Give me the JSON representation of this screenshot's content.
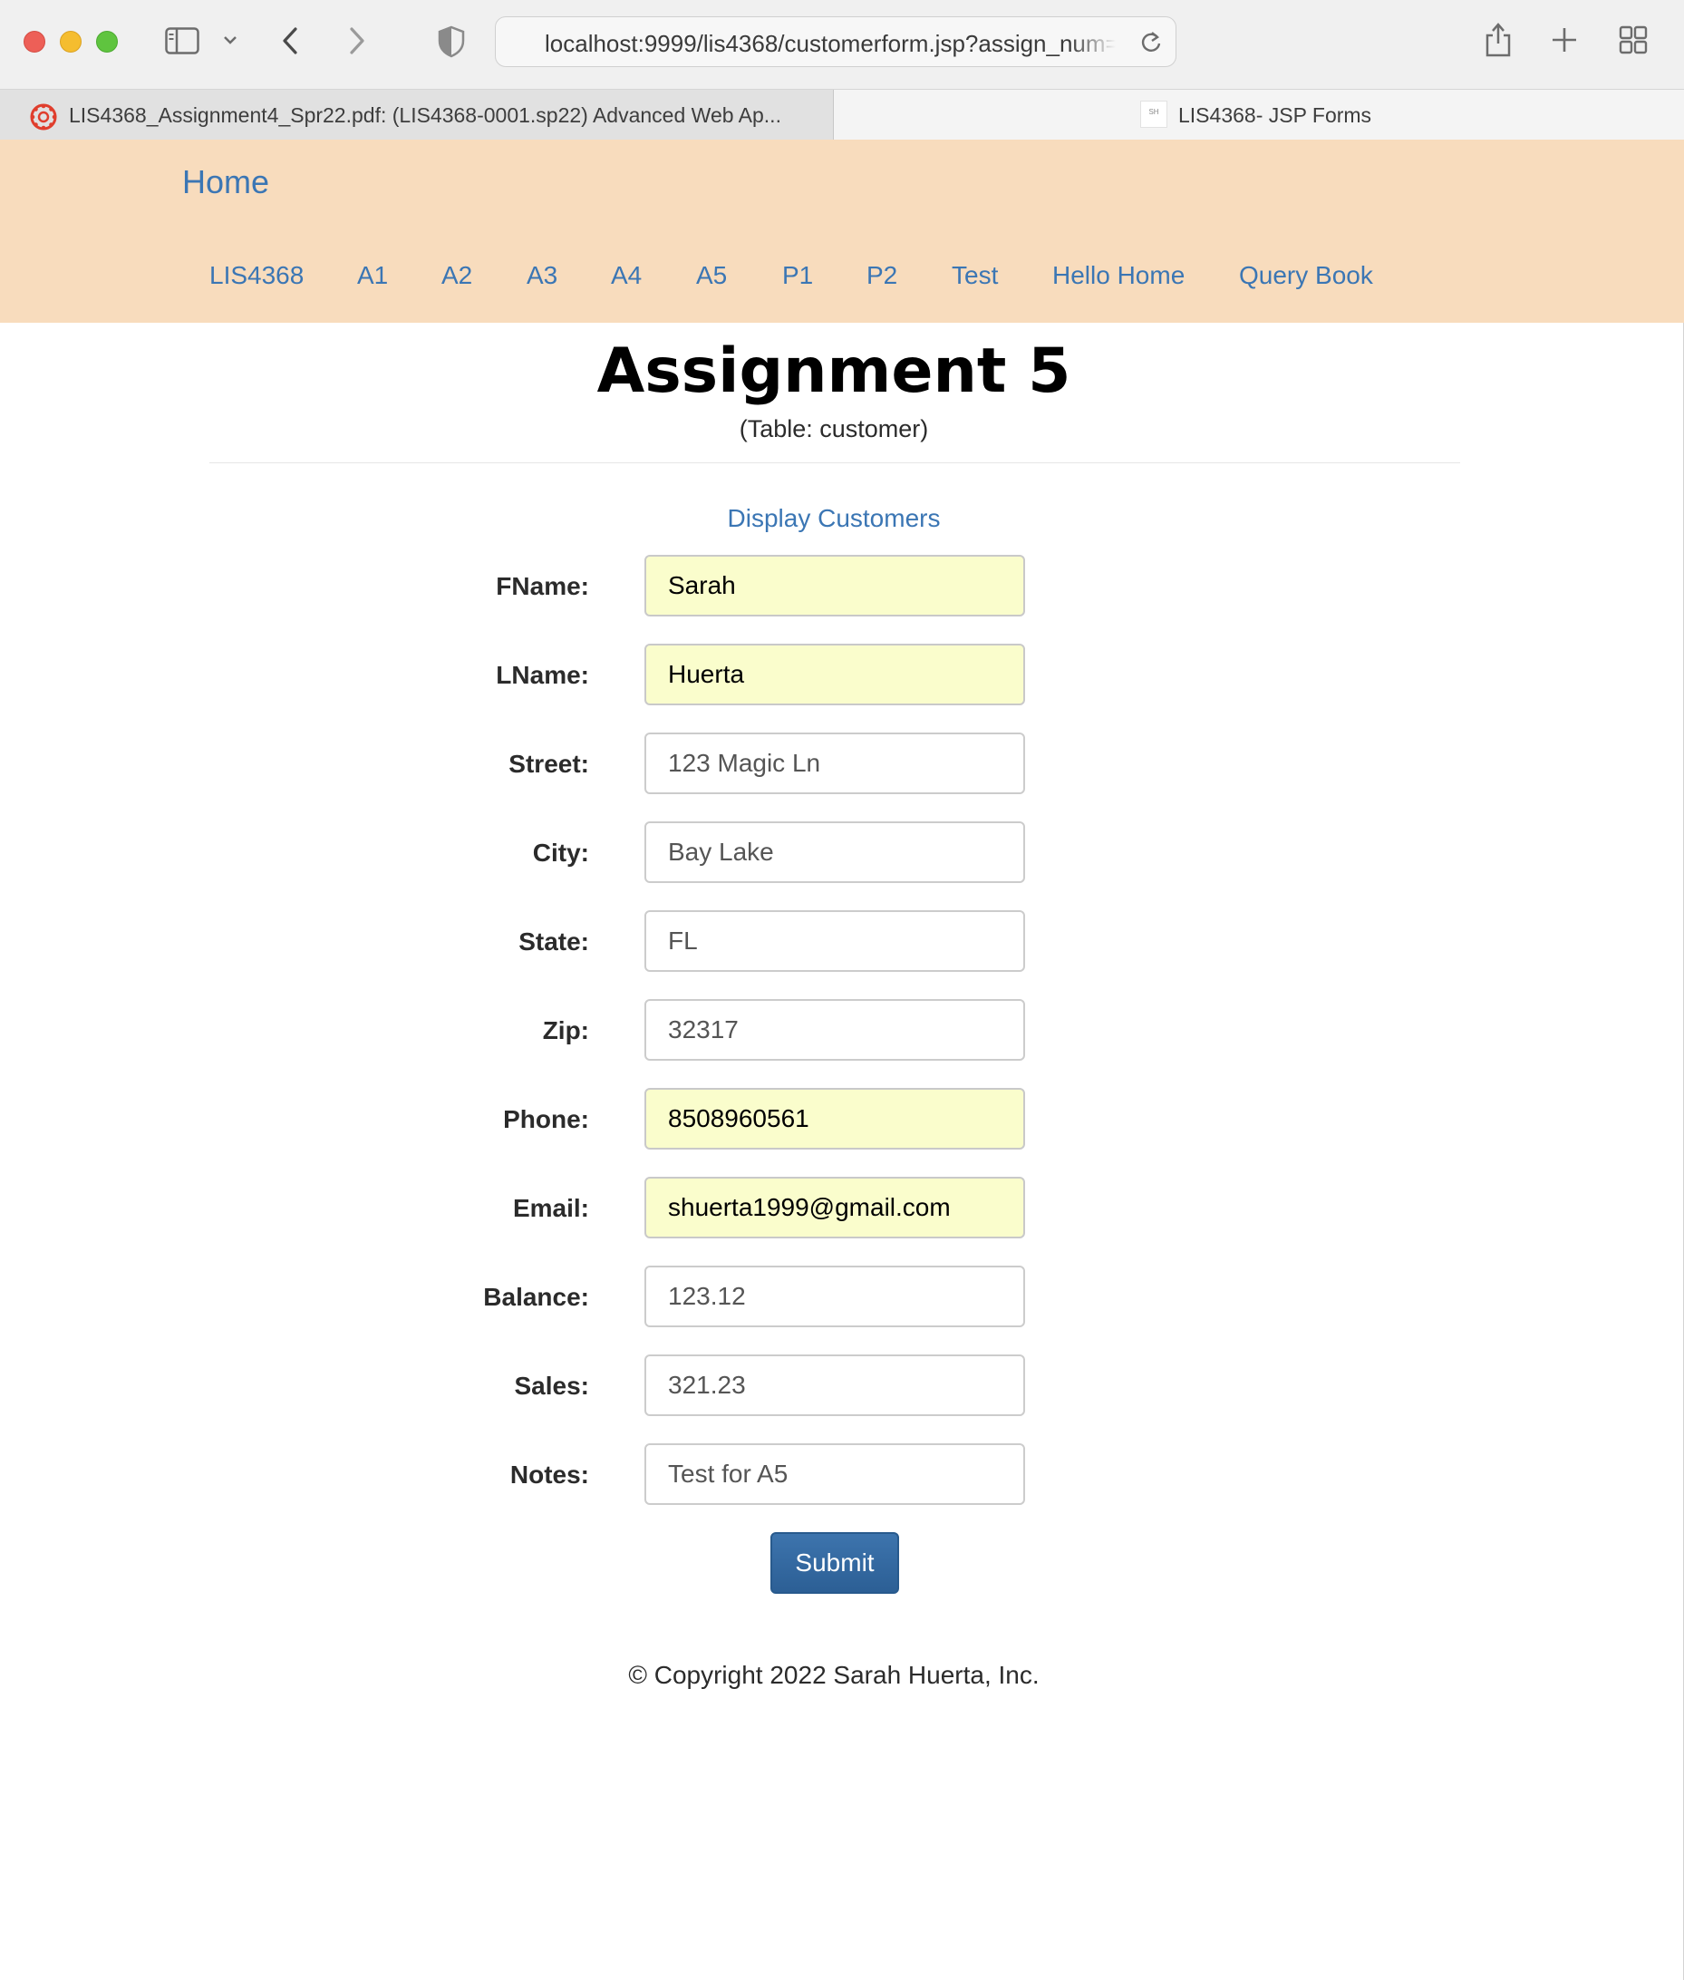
{
  "browser": {
    "url": "localhost:9999/lis4368/customerform.jsp?assign_num=a5",
    "tabs": [
      {
        "title": "LIS4368_Assignment4_Spr22.pdf: (LIS4368-0001.sp22) Advanced Web Ap...",
        "favicon": "canvas-logo-icon"
      },
      {
        "title": "LIS4368- JSP Forms",
        "favicon_text": "SH"
      }
    ]
  },
  "nav": {
    "brand": "Home",
    "links": [
      "LIS4368",
      "A1",
      "A2",
      "A3",
      "A4",
      "A5",
      "P1",
      "P2",
      "Test",
      "Hello Home",
      "Query Book"
    ]
  },
  "page": {
    "title": "Assignment 5",
    "subtitle": "(Table: customer)",
    "display_link": "Display Customers"
  },
  "form": {
    "fields": [
      {
        "label": "FName:",
        "value": "Sarah",
        "autofilled": true
      },
      {
        "label": "LName:",
        "value": "Huerta",
        "autofilled": true
      },
      {
        "label": "Street:",
        "value": "123 Magic Ln",
        "autofilled": false
      },
      {
        "label": "City:",
        "value": "Bay Lake",
        "autofilled": false
      },
      {
        "label": "State:",
        "value": "FL",
        "autofilled": false
      },
      {
        "label": "Zip:",
        "value": "32317",
        "autofilled": false
      },
      {
        "label": "Phone:",
        "value": "8508960561",
        "autofilled": true
      },
      {
        "label": "Email:",
        "value": "shuerta1999@gmail.com",
        "autofilled": true
      },
      {
        "label": "Balance:",
        "value": "123.12",
        "autofilled": false
      },
      {
        "label": "Sales:",
        "value": "321.23",
        "autofilled": false
      },
      {
        "label": "Notes:",
        "value": "Test for A5",
        "autofilled": false
      }
    ],
    "submit_label": "Submit"
  },
  "footer": {
    "copyright": "© Copyright 2022 Sarah Huerta, Inc."
  },
  "colors": {
    "nav_background": "#f8dcbd",
    "link": "#3b76b4",
    "autofill": "#fafdcc",
    "button": "#2c5f95"
  }
}
